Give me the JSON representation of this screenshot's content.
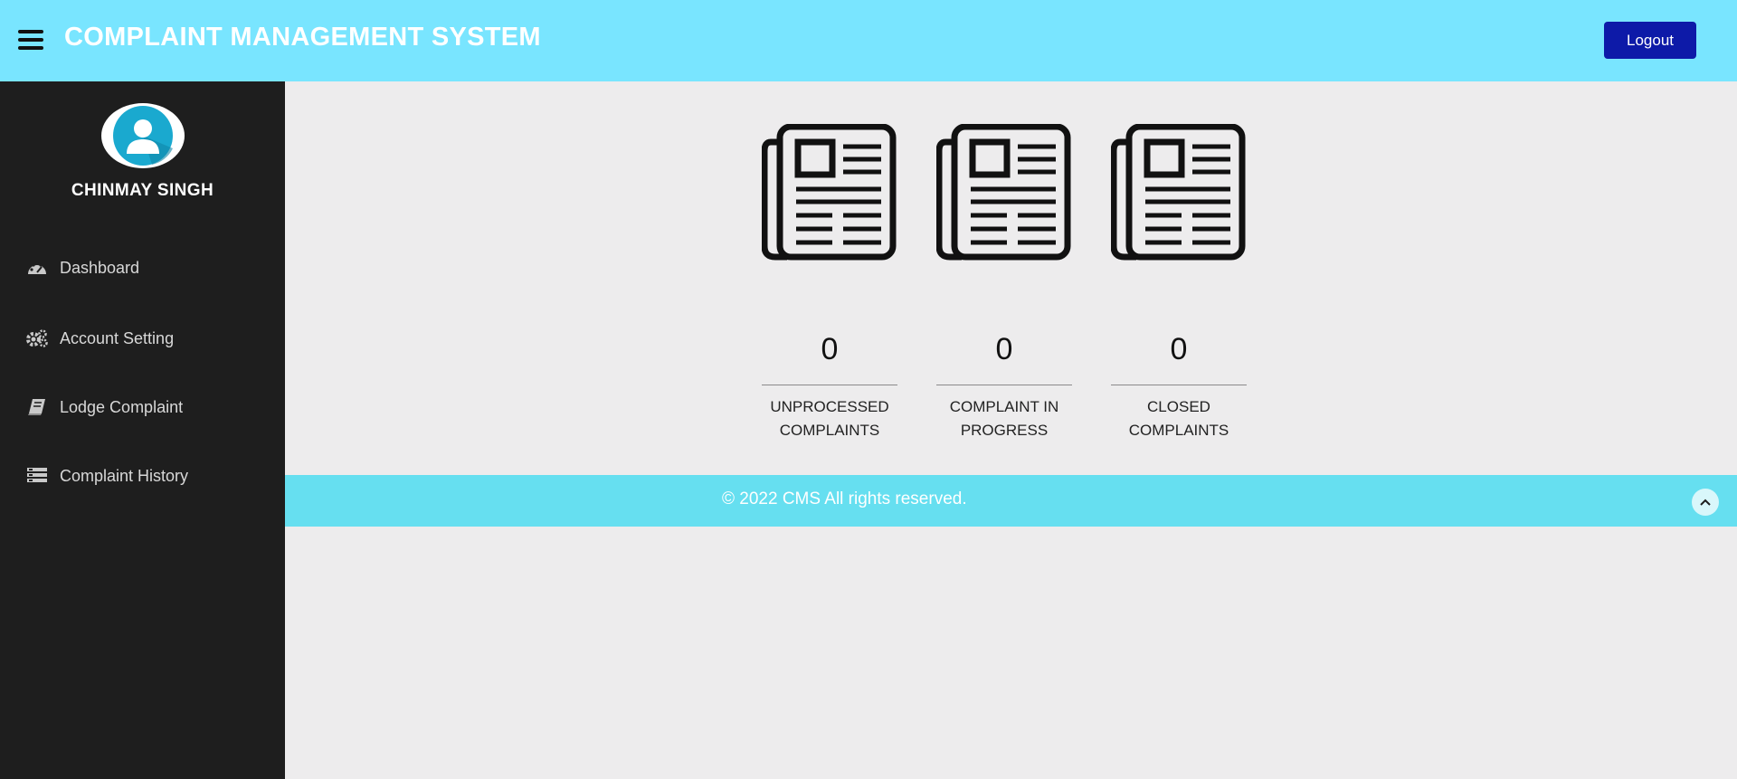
{
  "header": {
    "title": "COMPLAINT MANAGEMENT SYSTEM",
    "logout_label": "Logout",
    "background_color": "#79e5ff",
    "logout_color": "#0d1aa8"
  },
  "sidebar": {
    "user_name": "CHINMAY SINGH",
    "items": [
      {
        "label": "Dashboard",
        "icon": "dashboard-gauge-icon"
      },
      {
        "label": "Account Setting",
        "icon": "gears-icon"
      },
      {
        "label": "Lodge Complaint",
        "icon": "book-icon"
      },
      {
        "label": "Complaint History",
        "icon": "list-icon"
      }
    ],
    "background_color": "#1e1e1e"
  },
  "stats": [
    {
      "count": "0",
      "label_line1": "UNPROCESSED",
      "label_line2": "COMPLAINTS",
      "icon": "newspaper-icon"
    },
    {
      "count": "0",
      "label_line1": "COMPLAINT IN",
      "label_line2": "PROGRESS",
      "icon": "newspaper-icon"
    },
    {
      "count": "0",
      "label_line1": "CLOSED",
      "label_line2": "COMPLAINTS",
      "icon": "newspaper-icon"
    }
  ],
  "footer": {
    "text": "© 2022 CMS All rights reserved.",
    "background_color": "#66dff0",
    "scroll_top_icon": "chevron-up-icon"
  }
}
